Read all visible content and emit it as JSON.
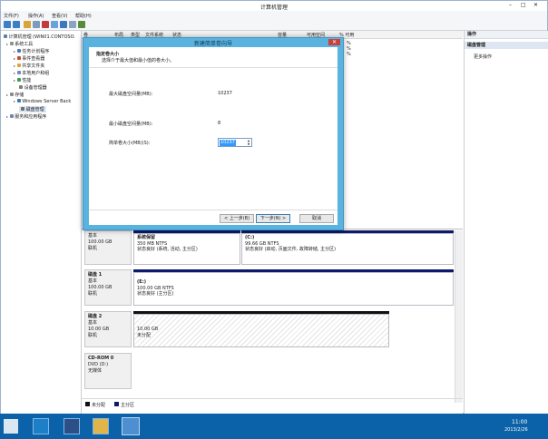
{
  "window": {
    "title": "计算机管理",
    "controls": [
      "–",
      "□",
      "✕"
    ]
  },
  "menu": [
    "文件(F)",
    "操作(A)",
    "查看(V)",
    "帮助(H)"
  ],
  "tree": {
    "root": "计算机管理 (WIN01.CONTOSO.",
    "system_tools": "系统工具",
    "system_children": [
      "任务计划程序",
      "事件查看器",
      "共享文件夹",
      "本地用户和组",
      "性能",
      "设备管理器"
    ],
    "storage": "存储",
    "storage_children": [
      "Windows Server Back",
      "磁盘管理"
    ],
    "services": "服务和应用程序"
  },
  "columns": [
    "卷",
    "布局",
    "类型",
    "文件系统",
    "状态",
    "容量",
    "可用空间",
    "% 可用"
  ],
  "col_pcts": [
    "%",
    "%",
    "%"
  ],
  "actions": {
    "header": "操作",
    "section": "磁盘管理",
    "more": "更多操作"
  },
  "dialog": {
    "title": "新建简单卷向导",
    "heading": "指定卷大小",
    "subheading": "选择介于最大值和最小值的卷大小。",
    "max_label": "最大磁盘空间量(MB):",
    "max_value": "10237",
    "min_label": "最小磁盘空间量(MB):",
    "min_value": "8",
    "size_label": "简单卷大小(MB)(S):",
    "size_value": "10237",
    "back": "< 上一步(B)",
    "next": "下一步(N) >",
    "cancel": "取消"
  },
  "disks": [
    {
      "name": "",
      "type": "基本",
      "size": "100.00 GB",
      "status": "联机",
      "volumes": [
        {
          "name": "系统保留",
          "info": "350 MB NTFS",
          "state": "状态良好 (系统, 活动, 主分区)"
        },
        {
          "name": "(C:)",
          "info": "99.66 GB NTFS",
          "state": "状态良好 (启动, 页面文件, 故障转储, 主分区)"
        }
      ]
    },
    {
      "name": "磁盘 1",
      "type": "基本",
      "size": "100.00 GB",
      "status": "联机",
      "volumes": [
        {
          "name": "(E:)",
          "info": "100.00 GB NTFS",
          "state": "状态良好 (主分区)"
        }
      ]
    },
    {
      "name": "磁盘 2",
      "type": "基本",
      "size": "10.00 GB",
      "status": "联机",
      "volumes": [
        {
          "name": "",
          "info": "10.00 GB",
          "state": "未分配"
        }
      ]
    },
    {
      "name": "CD-ROM 0",
      "type": "DVD (D:)",
      "size": "",
      "status": "无媒体",
      "volumes": []
    }
  ],
  "legend": [
    "未分配",
    "主分区"
  ],
  "taskbar": {
    "time": "11:00",
    "date": "2013/2/26"
  },
  "colors": {
    "primary_bar": "#0b1a6b",
    "unallocated_bar": "#111111",
    "dialog_frame": "#5ab3df",
    "taskbar": "#0b62a8",
    "selection": "#3399ff"
  }
}
